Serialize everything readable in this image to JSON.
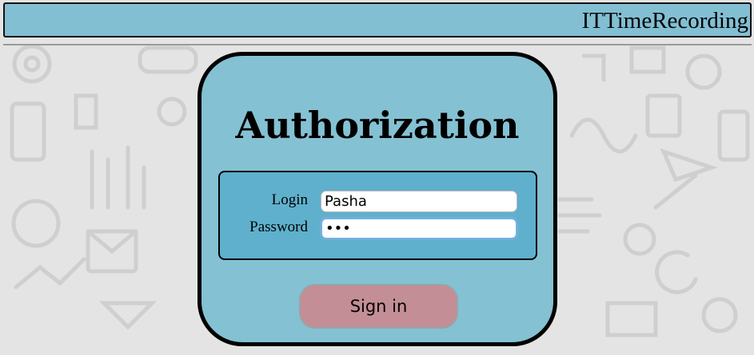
{
  "app": {
    "title": "ITTimeRecording"
  },
  "auth": {
    "heading": "Authorization",
    "login_label": "Login",
    "login_value": "Pasha",
    "password_label": "Password",
    "password_value": "•••",
    "signin_label": "Sign in"
  },
  "colors": {
    "header_bg": "#82bfd3",
    "card_bg": "#7dbed2",
    "form_bg": "#5fb0cc",
    "button_bg": "#c48e96",
    "page_bg": "#e4e4e4"
  }
}
